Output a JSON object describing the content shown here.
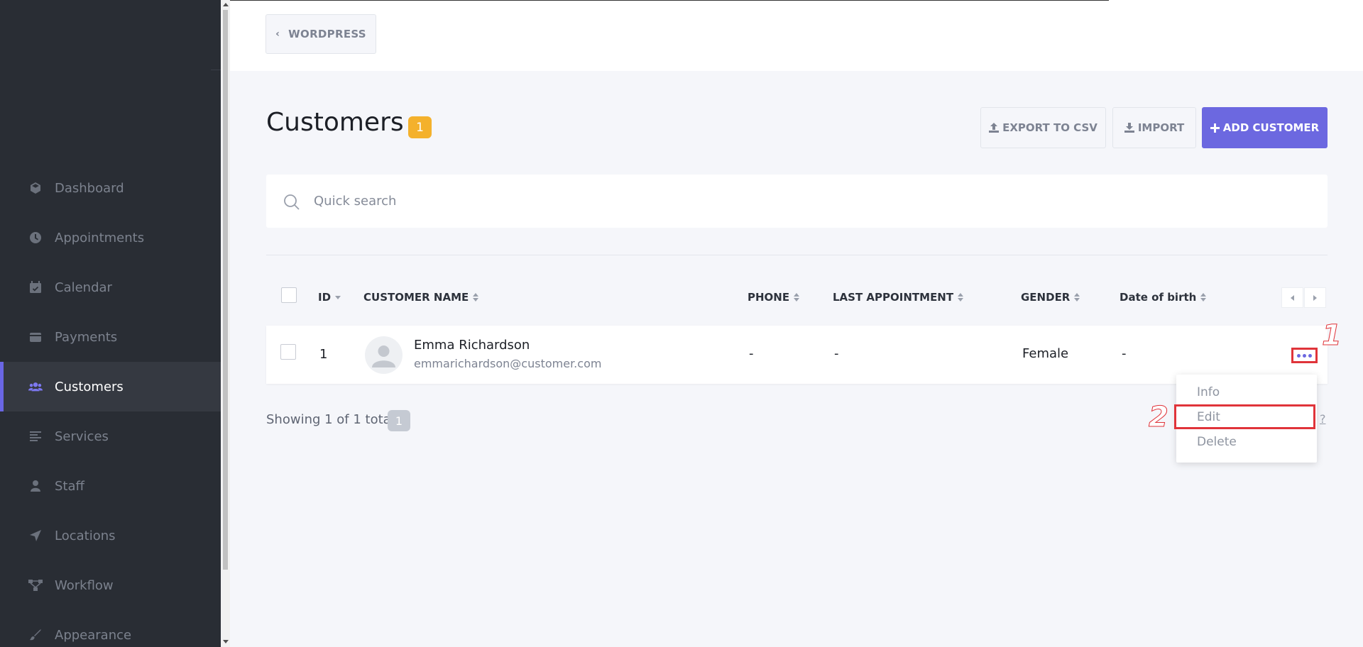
{
  "sidebar": {
    "items": [
      {
        "label": "Dashboard",
        "icon": "dashboard-icon"
      },
      {
        "label": "Appointments",
        "icon": "clock-icon"
      },
      {
        "label": "Calendar",
        "icon": "calendar-icon"
      },
      {
        "label": "Payments",
        "icon": "wallet-icon"
      },
      {
        "label": "Customers",
        "icon": "users-icon",
        "active": true
      },
      {
        "label": "Services",
        "icon": "list-icon"
      },
      {
        "label": "Staff",
        "icon": "person-icon"
      },
      {
        "label": "Locations",
        "icon": "location-arrow-icon"
      },
      {
        "label": "Workflow",
        "icon": "workflow-icon"
      },
      {
        "label": "Appearance",
        "icon": "brush-icon"
      }
    ]
  },
  "topbar": {
    "back_label": "WORDPRESS"
  },
  "header": {
    "title": "Customers",
    "count": "1",
    "export_label": "EXPORT TO CSV",
    "import_label": "IMPORT",
    "add_label": "ADD CUSTOMER"
  },
  "search": {
    "placeholder": "Quick search"
  },
  "table": {
    "columns": {
      "id": "ID",
      "name": "CUSTOMER NAME",
      "phone": "PHONE",
      "last_appointment": "LAST APPOINTMENT",
      "gender": "GENDER",
      "dob": "Date of birth"
    },
    "rows": [
      {
        "id": "1",
        "name": "Emma Richardson",
        "email": "emmarichardson@customer.com",
        "phone": "-",
        "last_appointment": "-",
        "gender": "Female",
        "dob": "-"
      }
    ]
  },
  "footer": {
    "showing": "Showing 1 of 1 total",
    "total_badge": "1",
    "help": "?"
  },
  "dropdown": {
    "items": [
      "Info",
      "Edit",
      "Delete"
    ]
  },
  "annotations": {
    "step1": "1",
    "step2": "2"
  },
  "colors": {
    "accent": "#6c68e0",
    "badge": "#f4b12c",
    "sidebar": "#292d34",
    "annotation": "#e0343a"
  }
}
